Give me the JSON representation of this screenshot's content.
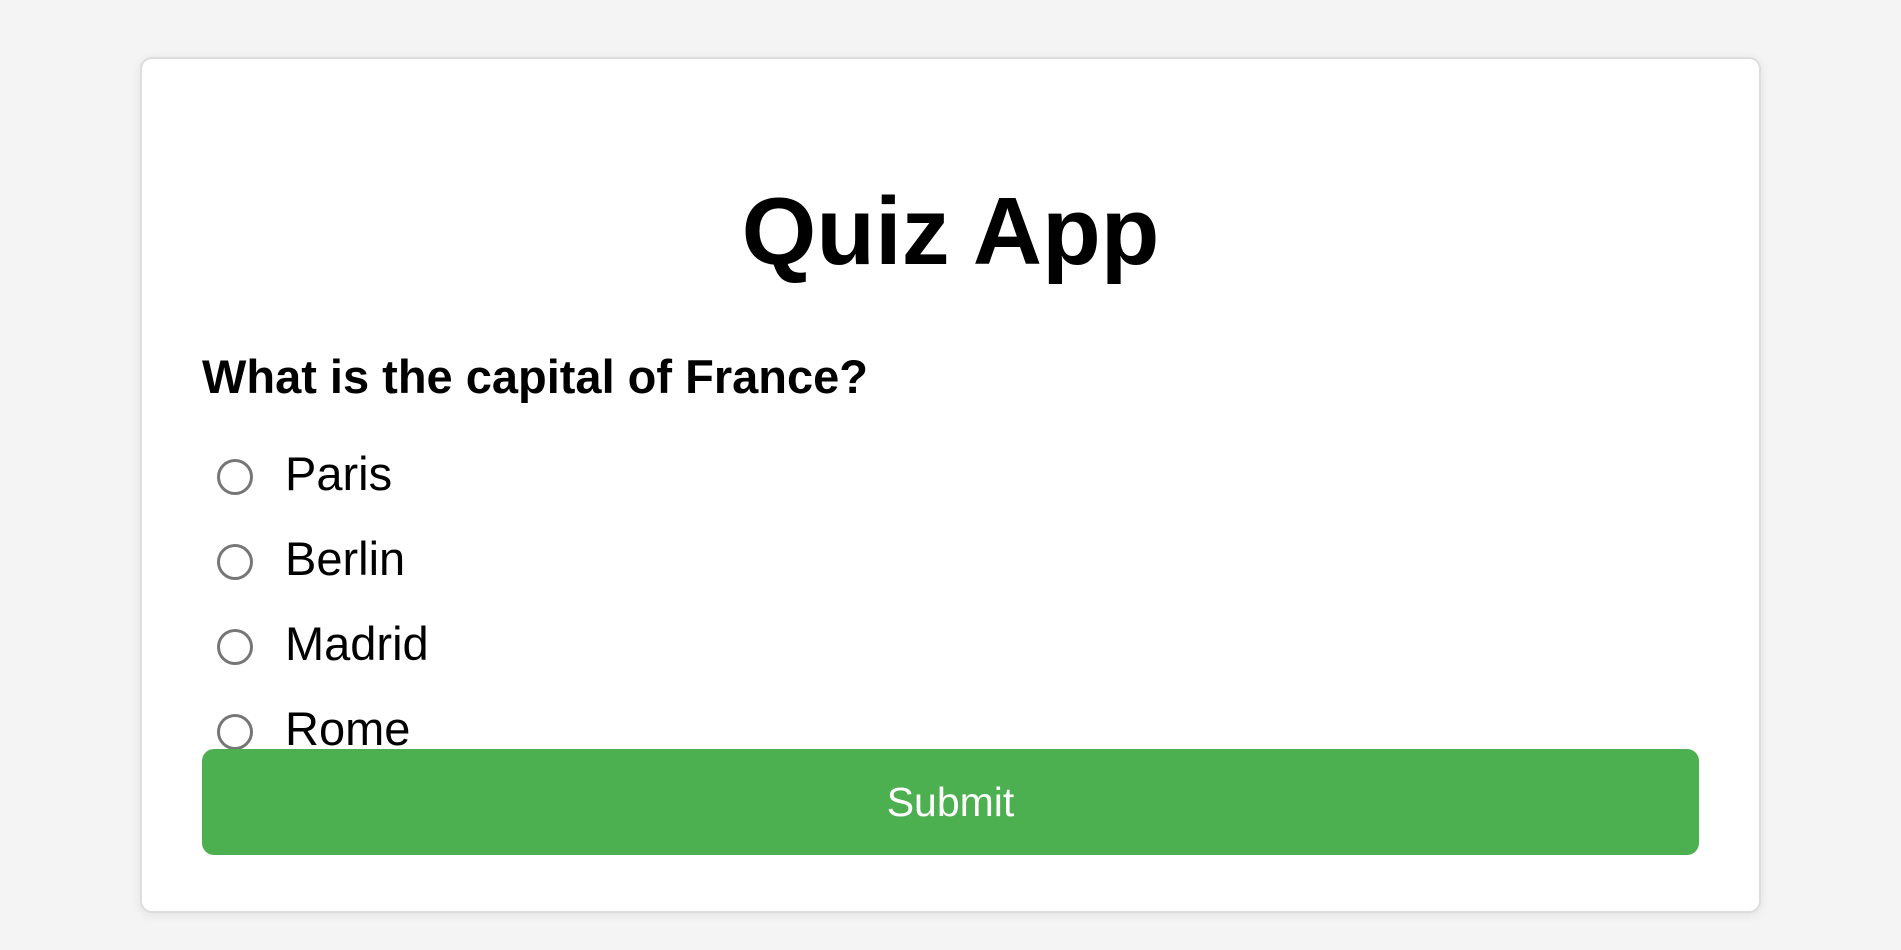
{
  "app": {
    "title": "Quiz App"
  },
  "quiz": {
    "question": "What is the capital of France?",
    "options": [
      {
        "label": "Paris",
        "selected": false
      },
      {
        "label": "Berlin",
        "selected": false
      },
      {
        "label": "Madrid",
        "selected": false
      },
      {
        "label": "Rome",
        "selected": false
      }
    ],
    "submit_label": "Submit"
  },
  "colors": {
    "background": "#f4f4f4",
    "card": "#ffffff",
    "accent": "#4caf50",
    "button_text": "#ffffff"
  },
  "icons": {
    "radio": "radio-unchecked-icon"
  }
}
